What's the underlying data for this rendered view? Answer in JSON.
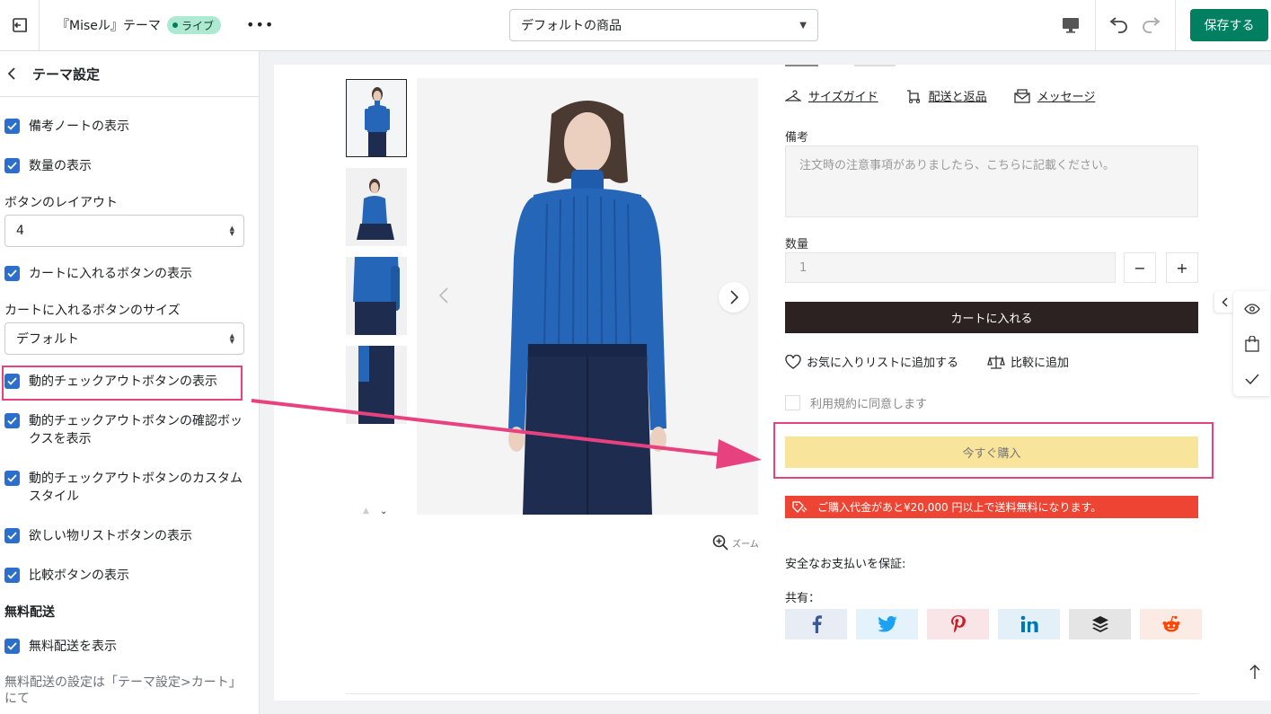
{
  "topbar": {
    "theme_name": "『Miseル』テーマ",
    "live_badge": "ライブ",
    "more": "•••",
    "template_select": "デフォルトの商品",
    "save_label": "保存する"
  },
  "sidebar": {
    "title": "テーマ設定",
    "items": [
      {
        "label": "備考ノートの表示"
      },
      {
        "label": "数量の表示"
      },
      {
        "label": "カートに入れるボタンの表示"
      },
      {
        "label": "動的チェックアウトボタンの表示"
      },
      {
        "label": "動的チェックアウトボタンの確認ボックスを表示"
      },
      {
        "label": "動的チェックアウトボタンのカスタムスタイル"
      },
      {
        "label": "欲しい物リストボタンの表示"
      },
      {
        "label": "比較ボタンの表示"
      },
      {
        "label": "無料配送を表示"
      }
    ],
    "button_layout_label": "ボタンのレイアウト",
    "button_layout_value": "4",
    "cart_button_size_label": "カートに入れるボタンのサイズ",
    "cart_button_size_value": "デフォルト",
    "free_shipping_heading": "無料配送",
    "free_shipping_help": "無料配送の設定は「テーマ設定>カート」にて"
  },
  "product": {
    "links": [
      "サイズガイド",
      "配送と返品",
      "メッセージ"
    ],
    "note_label": "備考",
    "note_placeholder": "注文時の注意事項がありましたら、こちらに記載ください。",
    "quantity_label": "数量",
    "quantity_value": "1",
    "minus": "−",
    "plus": "+",
    "add_to_cart": "カートに入れる",
    "wishlist": "お気に入りリストに追加する",
    "compare": "比較に追加",
    "terms": "利用規約に同意します",
    "buy_now": "今すぐ購入",
    "free_ship_notice": "ご購入代金があと¥20,000 円以上で送料無料になります。",
    "zoom": "ズーム",
    "secure_payment": "安全なお支払いを保証:",
    "share_label": "共有："
  },
  "colors": {
    "accent": "#008060",
    "checkbox": "#2c6ecb",
    "highlight": "#e8417f",
    "cart_button": "#2b2221",
    "buy_now": "#f8e49a",
    "notice": "#ee4433",
    "sweater": "#2566b8"
  },
  "share_icons": [
    "facebook-icon",
    "twitter-icon",
    "pinterest-icon",
    "linkedin-icon",
    "buffer-icon",
    "reddit-icon"
  ]
}
